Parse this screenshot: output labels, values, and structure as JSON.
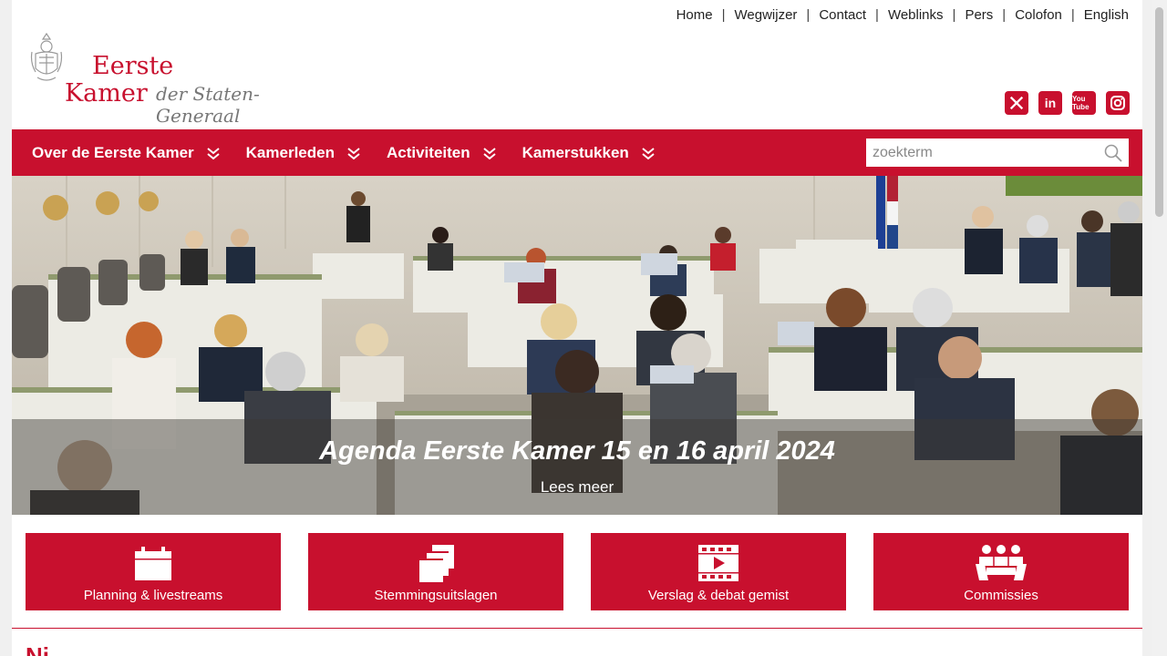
{
  "toplinks": [
    {
      "label": "Home"
    },
    {
      "label": "Wegwijzer"
    },
    {
      "label": "Contact"
    },
    {
      "label": "Weblinks"
    },
    {
      "label": "Pers"
    },
    {
      "label": "Colofon"
    },
    {
      "label": "English"
    }
  ],
  "logo": {
    "line1": "Eerste",
    "line2": "Kamer",
    "line3": "der Staten-Generaal"
  },
  "social": [
    {
      "icon": "x-icon",
      "glyph": "X"
    },
    {
      "icon": "linkedin-icon",
      "glyph": "in"
    },
    {
      "icon": "youtube-icon",
      "glyph": "You Tube"
    },
    {
      "icon": "instagram-icon",
      "glyph": ""
    }
  ],
  "nav": {
    "items": [
      {
        "label": "Over de Eerste Kamer"
      },
      {
        "label": "Kamerleden"
      },
      {
        "label": "Activiteiten"
      },
      {
        "label": "Kamerstukken"
      }
    ],
    "search_placeholder": "zoekterm"
  },
  "hero": {
    "title": "Agenda Eerste Kamer 15 en 16 april 2024",
    "link": "Lees meer"
  },
  "tiles": [
    {
      "label": "Planning & livestreams",
      "icon": "calendar-icon"
    },
    {
      "label": "Stemmingsuitslagen",
      "icon": "documents-icon"
    },
    {
      "label": "Verslag & debat gemist",
      "icon": "video-icon"
    },
    {
      "label": "Commissies",
      "icon": "people-icon"
    }
  ],
  "news": {
    "heading": "Ni"
  },
  "colors": {
    "brand": "#c8102e"
  }
}
